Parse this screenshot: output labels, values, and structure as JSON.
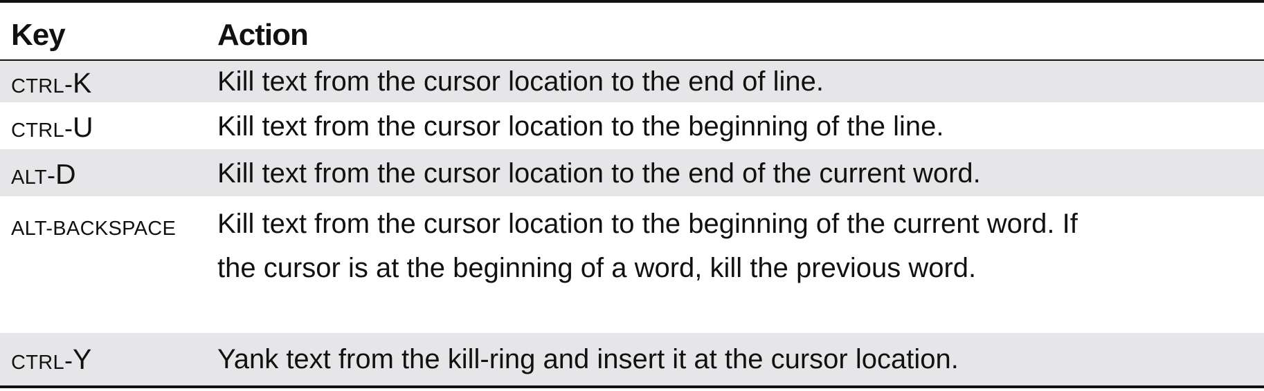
{
  "table": {
    "headers": {
      "key": "Key",
      "action": "Action"
    },
    "rows": [
      {
        "key_modifier": "CTRL",
        "key_dash": "-",
        "key_letter": "K",
        "action_lines": [
          "Kill text from the cursor location to the end of line."
        ]
      },
      {
        "key_modifier": "CTRL",
        "key_dash": "-",
        "key_letter": "U",
        "action_lines": [
          "Kill text from the cursor location to the beginning of the line."
        ]
      },
      {
        "key_modifier": "ALT",
        "key_dash": "-",
        "key_letter": "D",
        "action_lines": [
          "Kill text from the cursor location to the end of the current word."
        ]
      },
      {
        "key_modifier": "ALT-BACKSPACE",
        "key_dash": "",
        "key_letter": "",
        "action_lines": [
          "Kill text from the cursor location to the beginning of the current word. If",
          "the cursor is at the beginning of a word, kill the previous word."
        ]
      },
      {
        "key_modifier": "CTRL",
        "key_dash": "-",
        "key_letter": "Y",
        "action_lines": [
          "Yank text from the kill-ring and insert it at the cursor location."
        ]
      }
    ]
  }
}
